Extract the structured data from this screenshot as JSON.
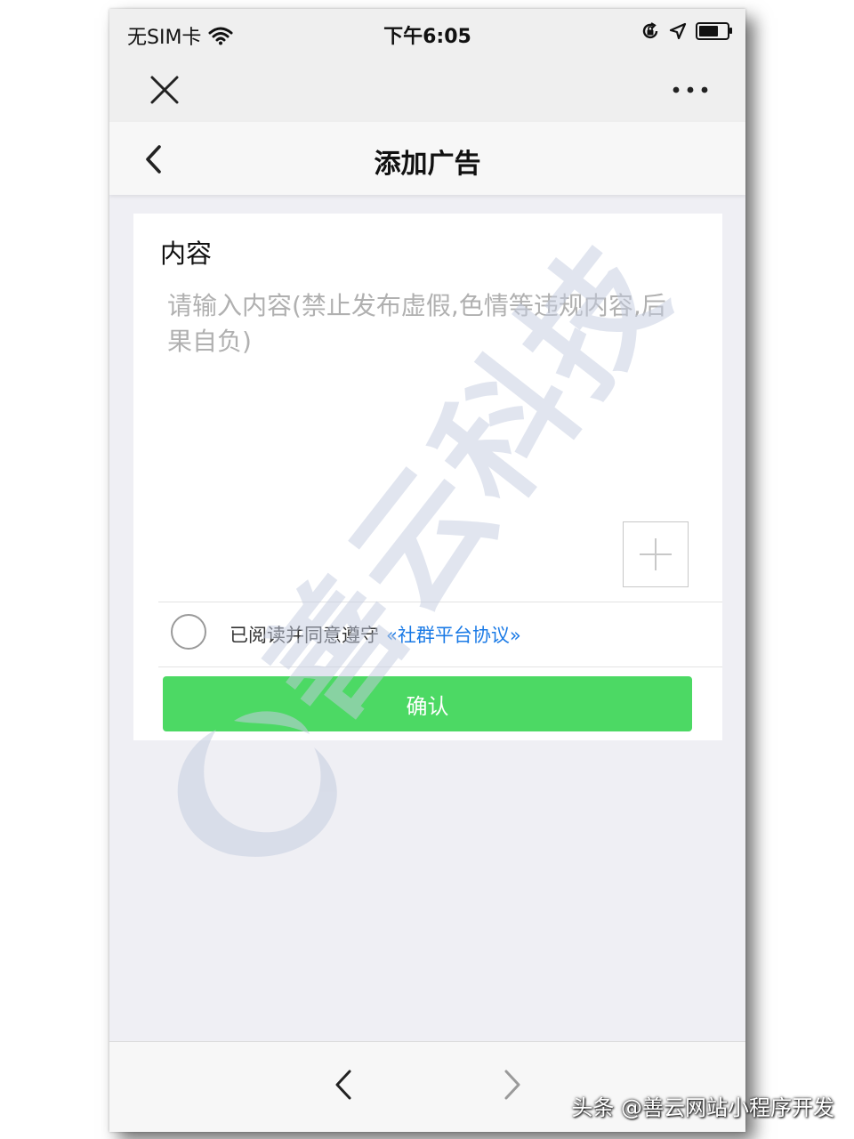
{
  "status_bar": {
    "carrier": "无SIM卡",
    "time": "下午6:05",
    "battery_level": 0.8
  },
  "capsule": {
    "close_icon": "close-icon",
    "more_icon": "more-dots-icon"
  },
  "nav": {
    "title": "添加广告"
  },
  "form": {
    "content_label": "内容",
    "content_placeholder": "请输入内容(禁止发布虚假,色情等违规内容,后果自负)",
    "content_value": "",
    "agree_text": "已阅读并同意遵守",
    "agree_link": "«社群平台协议»",
    "agree_checked": false,
    "confirm_label": "确认"
  },
  "watermark": {
    "text": "善云科技"
  },
  "source_caption": "头条 @善云网站小程序开发",
  "colors": {
    "accent_green": "#4cd964",
    "link_blue": "#1a7ae6",
    "background": "#efeff4",
    "watermark": "#c5cde0"
  }
}
